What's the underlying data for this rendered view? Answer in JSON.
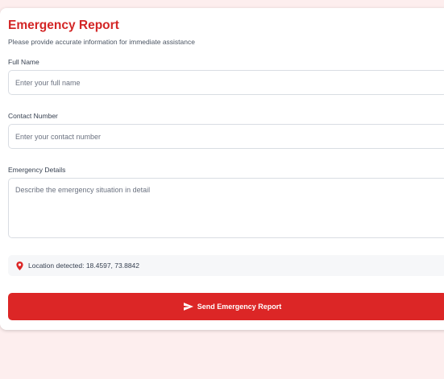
{
  "form": {
    "title": "Emergency Report",
    "subtitle": "Please provide accurate information for immediate assistance",
    "full_name": {
      "label": "Full Name",
      "placeholder": "Enter your full name",
      "value": ""
    },
    "contact_number": {
      "label": "Contact Number",
      "placeholder": "Enter your contact number",
      "value": ""
    },
    "emergency_details": {
      "label": "Emergency Details",
      "placeholder": "Describe the emergency situation in detail",
      "value": ""
    },
    "location": {
      "text": "Location detected: 18.4597, 73.8842",
      "icon": "map-pin-icon"
    },
    "submit": {
      "label": "Send Emergency Report",
      "icon": "send-icon"
    }
  },
  "colors": {
    "accent": "#dc2626",
    "title": "#d32626",
    "page_background": "#fdeeee"
  }
}
